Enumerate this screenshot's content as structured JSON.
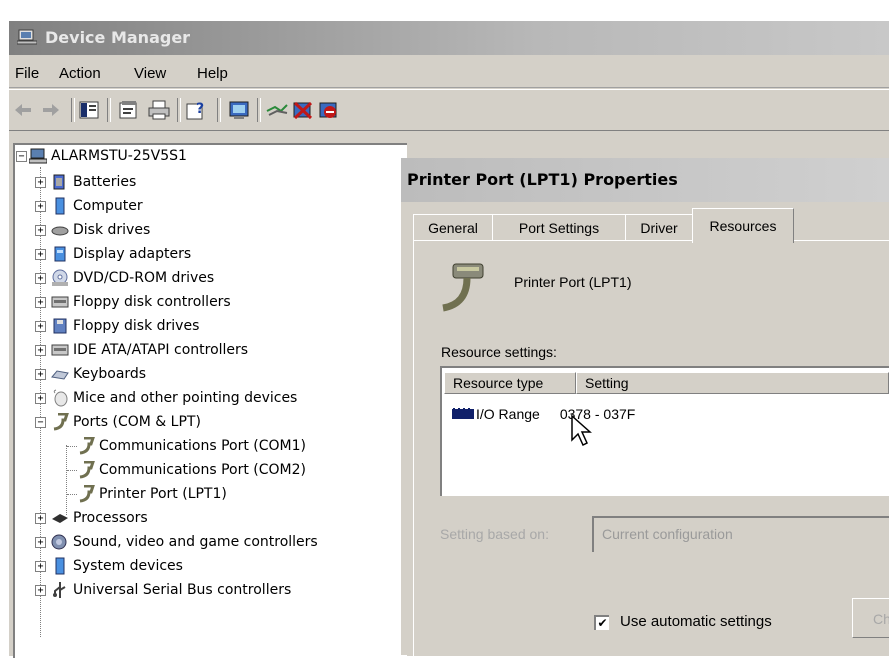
{
  "window": {
    "title": "Device Manager"
  },
  "menu": [
    "File",
    "Action",
    "View",
    "Help"
  ],
  "toolbar": {
    "buttons": [
      "back-icon",
      "forward-icon",
      "console-tree-icon",
      "properties-icon",
      "print-icon",
      "help-icon",
      "scan-hardware-icon",
      "update-driver-icon",
      "uninstall-icon",
      "disable-icon"
    ]
  },
  "tree": {
    "root": "ALARMSTU-25V5S1",
    "categories": [
      "Batteries",
      "Computer",
      "Disk drives",
      "Display adapters",
      "DVD/CD-ROM drives",
      "Floppy disk controllers",
      "Floppy disk drives",
      "IDE ATA/ATAPI controllers",
      "Keyboards",
      "Mice and other pointing devices",
      "Ports (COM & LPT)",
      "Processors",
      "Sound, video and game controllers",
      "System devices",
      "Universal Serial Bus controllers"
    ],
    "ports_children": [
      "Communications Port (COM1)",
      "Communications Port (COM2)",
      "Printer Port (LPT1)"
    ]
  },
  "dialog": {
    "title": "Printer Port (LPT1) Properties",
    "tabs": [
      "General",
      "Port Settings",
      "Driver",
      "Resources"
    ],
    "active_tab": "Resources",
    "device_name": "Printer Port (LPT1)",
    "resource_settings_label": "Resource settings:",
    "columns": [
      "Resource type",
      "Setting"
    ],
    "rows": [
      {
        "type": "I/O Range",
        "setting": "0378 - 037F"
      }
    ],
    "setting_based_on_label": "Setting based on:",
    "setting_based_on_value": "Current configuration",
    "use_automatic_label": "Use automatic settings",
    "use_automatic_checked": "✔",
    "change_button_label": "Ch"
  },
  "colors": {
    "face": "#d4d0c8",
    "shadow": "#808080",
    "title_inactive": "#b8b8b8"
  }
}
